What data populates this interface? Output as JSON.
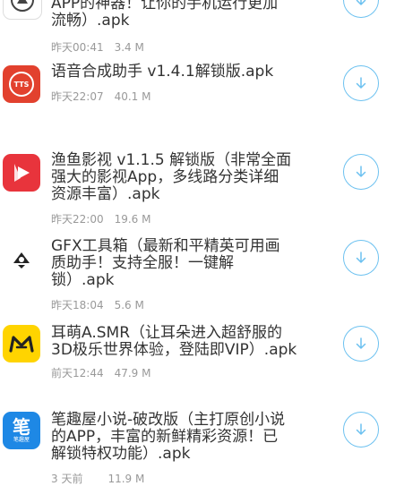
{
  "items": [
    {
      "title": "APP的神器！让你的手机运行更加\n流畅）.apk",
      "date": "昨天00:41",
      "size": "3.4 M",
      "icon": "partial-app-icon"
    },
    {
      "title": "语音合成助手 v1.4.1解锁版.apk",
      "date": "昨天22:07",
      "size": "40.1 M",
      "icon": "tts-icon",
      "icon_text": "TTS"
    },
    {
      "title": "渔鱼影视 v1.1.5 解锁版（非常全面\n强大的影视App，多线路分类详细\n资源丰富）.apk",
      "date": "昨天22:00",
      "size": "19.6 M",
      "icon": "video-play-icon"
    },
    {
      "title": "GFX工具箱（最新和平精英可用画\n质助手！支持全服！一键解\n锁）.apk",
      "date": "昨天18:04",
      "size": "5.6 M",
      "icon": "gfx-tool-icon"
    },
    {
      "title": "耳萌A.SMR（让耳朵进入超舒服的\n3D极乐世界体验，登陆即VIP）.apk",
      "date": "前天12:44",
      "size": "47.9 M",
      "icon": "ear-asmr-icon"
    },
    {
      "title": "笔趣屋小说-破改版（主打原创小说\n的APP，丰富的新鲜精彩资源！已\n解锁特权功能）.apk",
      "date": "3 天前",
      "size": "11.9 M",
      "icon": "novel-app-icon",
      "icon_text": "笔",
      "icon_subtext": "笔趣屋"
    }
  ],
  "colors": {
    "title": "#333333",
    "meta": "#999999",
    "download": "#6cc1f0",
    "tts_bg": "#e2412e",
    "video_bg": "#e8343c",
    "ear_bg": "#ffd400",
    "novel_bg": "#1e88e5"
  }
}
